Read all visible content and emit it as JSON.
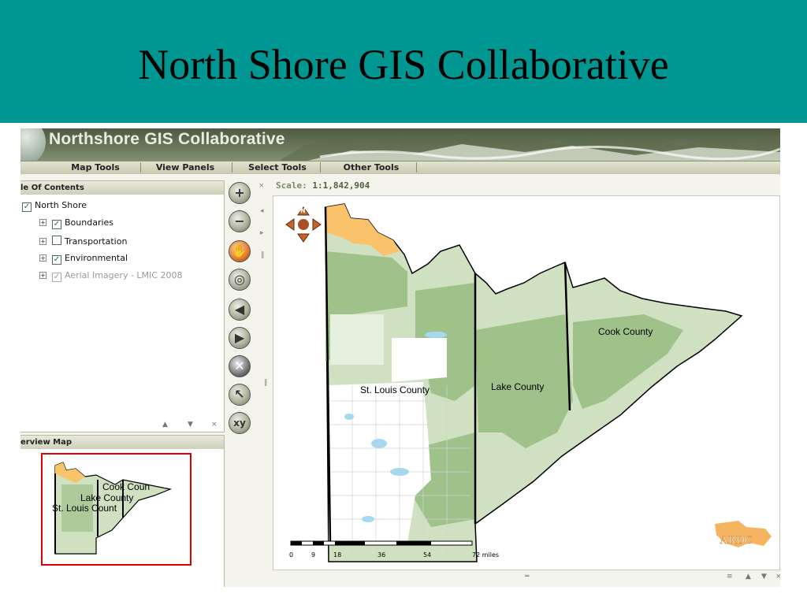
{
  "slide": {
    "title": "North Shore GIS Collaborative"
  },
  "app": {
    "title": "Northshore GIS Collaborative",
    "menu": [
      "Map Tools",
      "View Panels",
      "Select Tools",
      "Other Tools"
    ]
  },
  "toc": {
    "title": "le Of Contents",
    "root": {
      "label": "North Shore",
      "checked": true
    },
    "items": [
      {
        "label": "Boundaries",
        "checked": true
      },
      {
        "label": "Transportation",
        "checked": false
      },
      {
        "label": "Environmental",
        "checked": true
      },
      {
        "label": "Aerial Imagery - LMIC 2008",
        "checked": true,
        "disabled": true
      }
    ],
    "controls": [
      "▲",
      "▼",
      "×"
    ]
  },
  "overview": {
    "title": "erview Map",
    "labels": [
      "Cook Coun",
      "Lake County",
      "St. Louis Count"
    ]
  },
  "tools": [
    "zoom-in",
    "zoom-out",
    "pan",
    "full-extent",
    "back",
    "forward",
    "clear",
    "identify",
    "xy-locate"
  ],
  "map": {
    "scale_prefix": "Scale:",
    "scale_value": "1:1,842,904",
    "labels": [
      "St. Louis County",
      "Lake County",
      "Cook County"
    ],
    "scalebar": {
      "ticks": [
        "0",
        "9",
        "18",
        "36",
        "54",
        "72 miles"
      ]
    },
    "logo": "ARDC",
    "north": "N",
    "colors": {
      "forest": "#9fc18a",
      "light_green": "#cfe1c0",
      "orange": "#f9c26b",
      "water": "#a6d8ef",
      "banner": "#009792"
    }
  }
}
